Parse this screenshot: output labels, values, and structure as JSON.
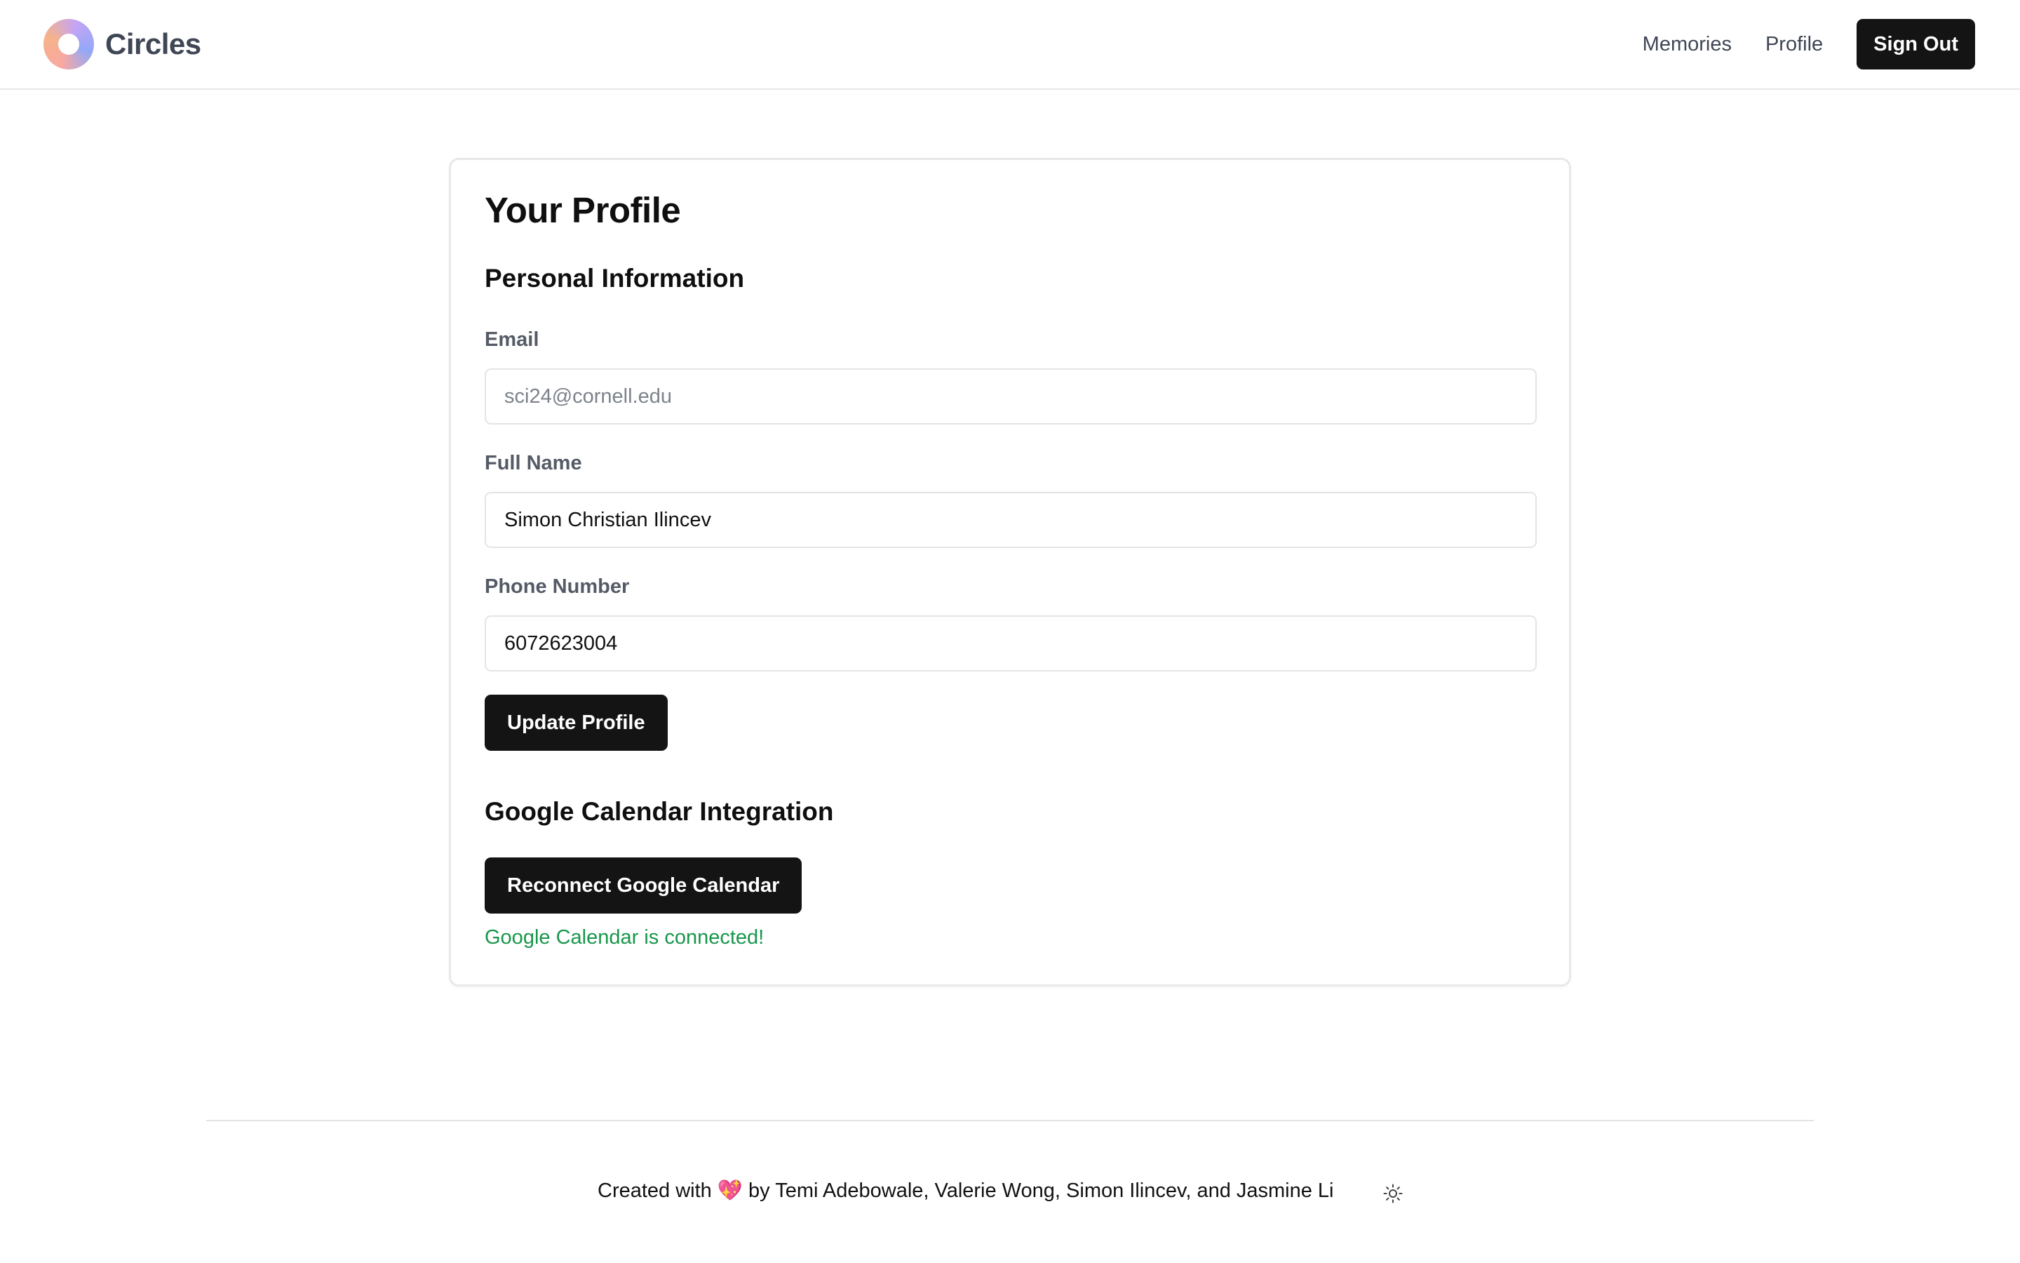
{
  "header": {
    "brand": "Circles",
    "nav": {
      "memories": "Memories",
      "profile": "Profile",
      "sign_out": "Sign Out"
    }
  },
  "profile_card": {
    "title": "Your Profile",
    "personal_info": {
      "heading": "Personal Information",
      "email": {
        "label": "Email",
        "value": "sci24@cornell.edu"
      },
      "full_name": {
        "label": "Full Name",
        "value": "Simon Christian Ilincev"
      },
      "phone": {
        "label": "Phone Number",
        "value": "6072623004"
      },
      "update_button": "Update Profile"
    },
    "google_calendar": {
      "heading": "Google Calendar Integration",
      "reconnect_button": "Reconnect Google Calendar",
      "status": "Google Calendar is connected!"
    }
  },
  "footer": {
    "credit_prefix": "Created with",
    "heart": "💖",
    "credit_suffix": "by Temi Adebowale, Valerie Wong, Simon Ilincev, and Jasmine Li",
    "theme_toggle_icon": "sun-icon"
  },
  "colors": {
    "primary_button": "#141414",
    "success_text": "#17964b",
    "label_text": "#555b66"
  }
}
